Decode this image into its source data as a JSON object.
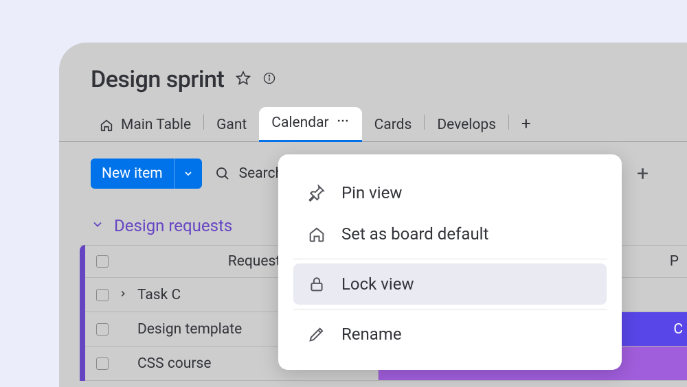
{
  "board": {
    "title": "Design sprint"
  },
  "tabs": {
    "main_table": "Main Table",
    "gant": "Gant",
    "calendar": "Calendar",
    "cards": "Cards",
    "develops": "Develops"
  },
  "toolbar": {
    "new_item": "New item",
    "search_placeholder": "Search"
  },
  "group": {
    "title": "Design requests",
    "col_request": "Request",
    "col_priority_abbrev": "P",
    "rows": [
      {
        "name": "Task C",
        "expandable": true
      },
      {
        "name": "Design template",
        "status_label": "C",
        "status_color": "blue"
      },
      {
        "name": "CSS course",
        "status_color": "purple"
      }
    ]
  },
  "dropdown": {
    "pin": "Pin view",
    "set_default": "Set as board default",
    "lock": "Lock view",
    "rename": "Rename"
  }
}
